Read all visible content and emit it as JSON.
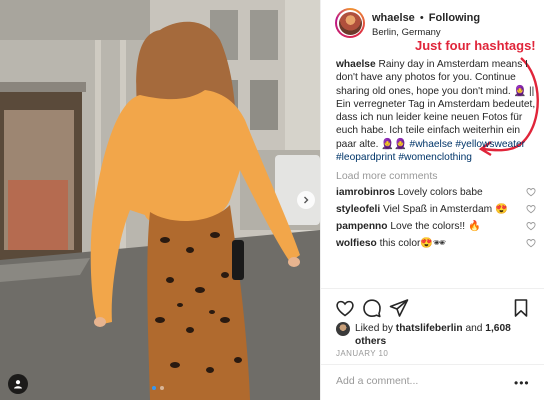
{
  "post": {
    "username": "whaelse",
    "follow_separator": "•",
    "follow_label": "Following",
    "location": "Berlin, Germany"
  },
  "annotation": {
    "text": "Just four hashtags!",
    "color": "#e0253a"
  },
  "caption": {
    "username": "whaelse",
    "text": "Rainy day in Amsterdam means I don't have any photos for you. Continue sharing old ones, hope you don't mind. 🧕 || Ein verregneter Tag in Amsterdam bedeutet, dass ich nun leider keine neuen Fotos für euch habe. Ich teile einfach weiterhin ein paar alte. 🧕🧕",
    "hashtags": [
      "#whaelse",
      "#yellowsweater",
      "#leopardprint",
      "#womenclothing"
    ]
  },
  "load_more_label": "Load more comments",
  "comments": [
    {
      "user": "iamrobinros",
      "text": "Lovely colors babe"
    },
    {
      "user": "styleofeli",
      "text": "Viel Spaß in Amsterdam 😍"
    },
    {
      "user": "pampenno",
      "text": "Love the colors!! 🔥"
    },
    {
      "user": "wolfieso",
      "text": "this color😍🕶"
    }
  ],
  "likes": {
    "prefix": "Liked by",
    "first_user": "thatslifeberlin",
    "conjunction": "and",
    "others": "1,608 others"
  },
  "date": "JANUARY 10",
  "add_comment_placeholder": "Add a comment...",
  "more_options": "•••",
  "icons": {
    "like": "heart-icon",
    "comment": "comment-icon",
    "share": "share-icon",
    "save": "bookmark-icon",
    "next": "chevron-right-icon",
    "tag": "user-tag-icon"
  },
  "colors": {
    "hashtag": "#003569",
    "muted": "#999999",
    "carousel_active": "#3897f0"
  },
  "carousel": {
    "slides": 2,
    "active_index": 0
  }
}
